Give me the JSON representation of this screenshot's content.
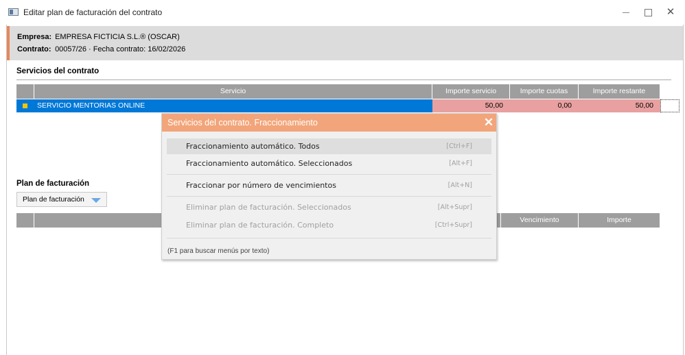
{
  "window": {
    "title": "Editar plan de facturación del contrato",
    "controls": {
      "minimize": "–",
      "maximize": "□",
      "close": "✕"
    }
  },
  "header": {
    "empresa_label": "Empresa:",
    "empresa_value": "EMPRESA FICTICIA S.L.® (OSCAR)",
    "contrato_label": "Contrato:",
    "contrato_value": "00057/26  ·  Fecha contrato: 16/02/2026",
    "accent_color": "#e8875a"
  },
  "servicios": {
    "title": "Servicios del contrato",
    "columns": [
      "Servicio",
      "Importe servicio",
      "Importe cuotas",
      "Importe restante"
    ],
    "rows": [
      {
        "servicio": "SERVICIO MENTORIAS ONLINE",
        "importe_servicio": "50,00",
        "importe_cuotas": "0,00",
        "importe_restante": "50,00"
      }
    ]
  },
  "plan": {
    "title": "Plan de facturación",
    "dropdown_label": "Plan de facturación",
    "columns": [
      "Vencimiento",
      "Importe"
    ]
  },
  "popup": {
    "title": "Servicios del contrato. Fraccionamiento",
    "close_icon": "✕",
    "items": [
      {
        "label": "Fraccionamiento automático. Todos",
        "shortcut": "[Ctrl+F]",
        "enabled": true,
        "highlighted": true
      },
      {
        "label": "Fraccionamiento automático. Seleccionados",
        "shortcut": "[Alt+F]",
        "enabled": true,
        "highlighted": false
      },
      {
        "label": "Fraccionar por número de vencimientos",
        "shortcut": "[Alt+N]",
        "enabled": true,
        "highlighted": false
      },
      {
        "label": "Eliminar plan de facturación. Seleccionados",
        "shortcut": "[Alt+Supr]",
        "enabled": false,
        "highlighted": false
      },
      {
        "label": "Eliminar plan de facturación. Completo",
        "shortcut": "[Ctrl+Supr]",
        "enabled": false,
        "highlighted": false
      }
    ],
    "hint": "(F1 para buscar menús por texto)"
  },
  "colors": {
    "selection_blue": "#0078d7",
    "header_gray": "#9e9e9e",
    "amount_pink": "#e8a0a0",
    "popup_title": "#f2a57a"
  }
}
